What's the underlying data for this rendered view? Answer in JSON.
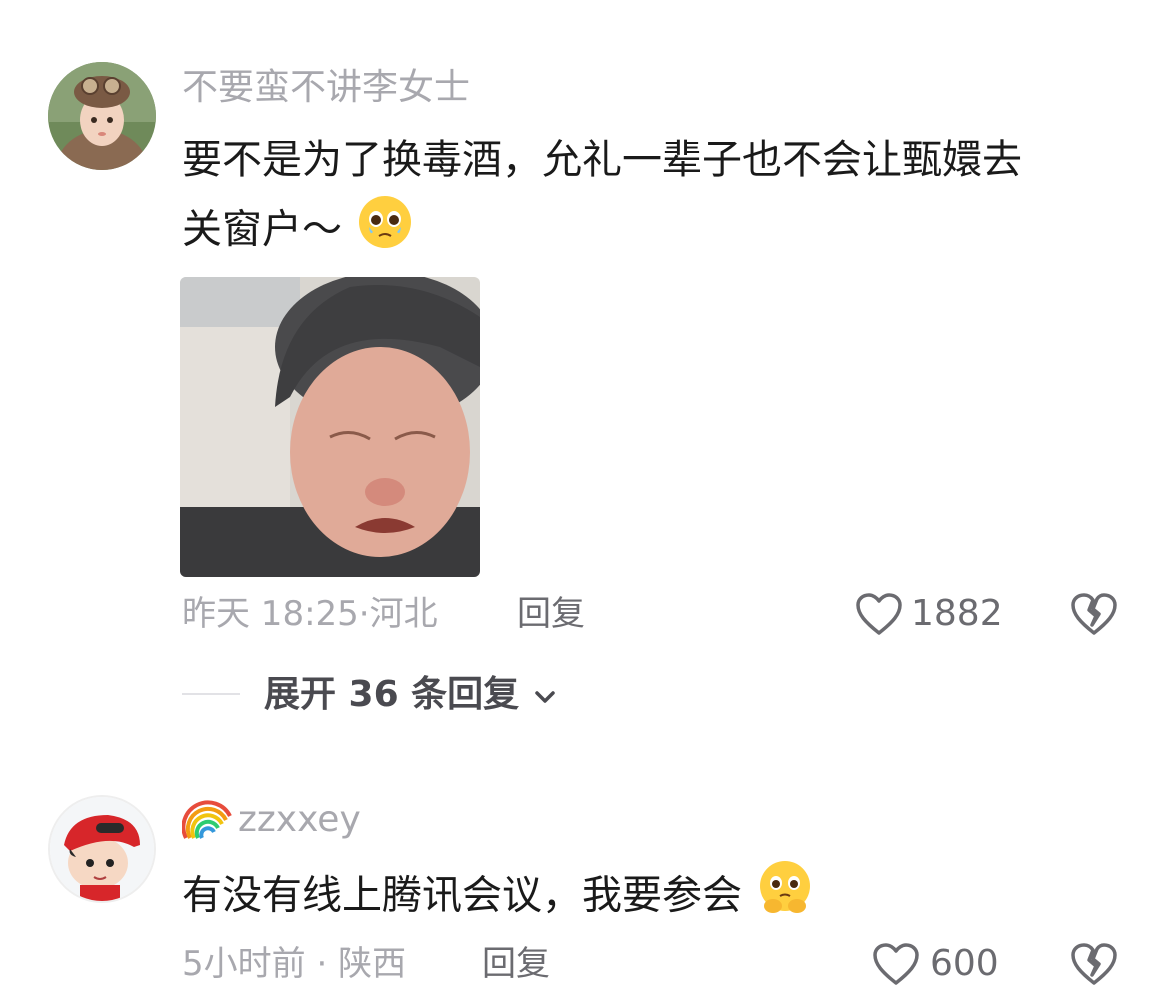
{
  "comments": [
    {
      "username": "不要蛮不讲李女士",
      "text_line1": "要不是为了换毒酒，允礼一辈子也不会让甄嬛去",
      "text_line2": "关窗户～",
      "text_emoji": "pleading-face-tears",
      "image_alt": "crying-face-photo",
      "time": "昨天 18:25",
      "location": "河北",
      "reply_label": "回复",
      "likes": "1882",
      "expand_label": "展开 36 条回复"
    },
    {
      "username_badge": "rainbow",
      "username": "zzxxey",
      "text": "有没有线上腾讯会议，我要参会",
      "text_emoji": "pleading-face-hands",
      "time": "5小时前",
      "location": "陕西",
      "reply_label": "回复",
      "likes": "600"
    }
  ],
  "colors": {
    "meta": "#a8a8ae",
    "text": "#1a1a1a",
    "background": "#ffffff"
  }
}
